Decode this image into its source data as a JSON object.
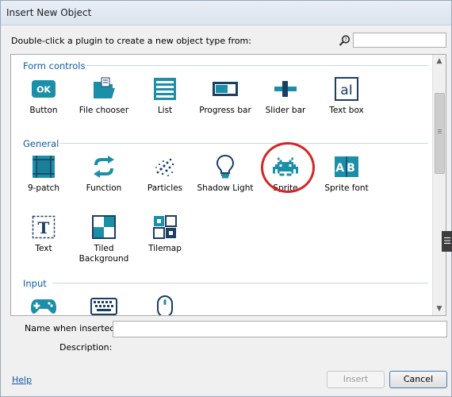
{
  "window": {
    "title": "Insert New Object",
    "instruction": "Double-click a plugin to create a new object type from:"
  },
  "search": {
    "value": "",
    "placeholder": ""
  },
  "categories": [
    {
      "name": "Form controls",
      "items": [
        {
          "label": "Button",
          "icon": "button-icon"
        },
        {
          "label": "File chooser",
          "icon": "folder-icon"
        },
        {
          "label": "List",
          "icon": "list-icon"
        },
        {
          "label": "Progress bar",
          "icon": "progress-bar-icon"
        },
        {
          "label": "Slider bar",
          "icon": "slider-icon"
        },
        {
          "label": "Text box",
          "icon": "text-box-icon"
        }
      ]
    },
    {
      "name": "General",
      "items": [
        {
          "label": "9-patch",
          "icon": "nine-patch-icon"
        },
        {
          "label": "Function",
          "icon": "function-icon"
        },
        {
          "label": "Particles",
          "icon": "particles-icon"
        },
        {
          "label": "Shadow Light",
          "icon": "lightbulb-icon"
        },
        {
          "label": "Sprite",
          "icon": "space-invader-icon"
        },
        {
          "label": "Sprite font",
          "icon": "sprite-font-icon"
        },
        {
          "label": "Text",
          "icon": "text-icon"
        },
        {
          "label": "Tiled Background",
          "icon": "tiled-background-icon"
        },
        {
          "label": "Tilemap",
          "icon": "tilemap-icon"
        }
      ]
    },
    {
      "name": "Input",
      "items": [
        {
          "label": "",
          "icon": "gamepad-icon"
        },
        {
          "label": "",
          "icon": "keyboard-icon"
        },
        {
          "label": "",
          "icon": "mouse-icon"
        }
      ]
    }
  ],
  "button_icon_text": "OK",
  "text_box_icon_text": "aI",
  "sprite_font_icon_text": "AB",
  "text_icon_text": "T",
  "fields": {
    "name_label": "Name when inserted:",
    "name_value": "",
    "description_label": "Description:"
  },
  "footer": {
    "help": "Help",
    "insert": "Insert",
    "cancel": "Cancel"
  },
  "colors": {
    "accent": "#1c8fa8",
    "accent_dark": "#1b3e63",
    "category": "#0e5aa7",
    "highlight_circle": "#d42626"
  }
}
